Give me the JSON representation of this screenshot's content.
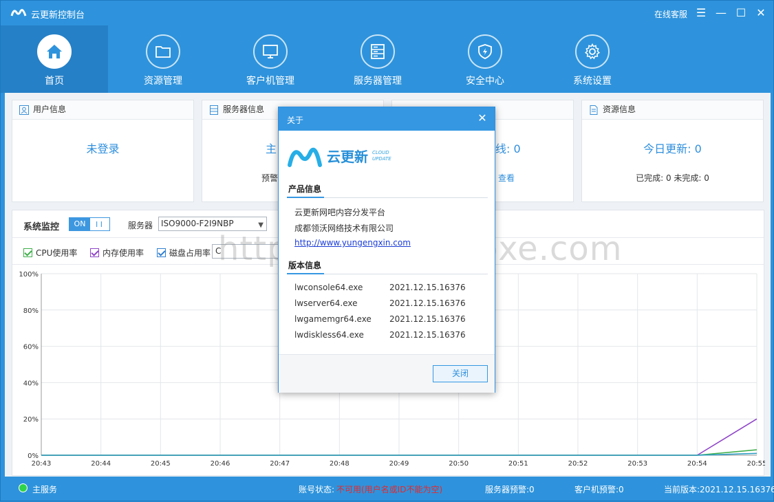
{
  "app": {
    "title": "云更新控制台",
    "online_service": "在线客服"
  },
  "nav": [
    {
      "label": "首页",
      "icon": "home-icon",
      "active": true
    },
    {
      "label": "资源管理",
      "icon": "folder-icon",
      "active": false
    },
    {
      "label": "客户机管理",
      "icon": "monitor-icon",
      "active": false
    },
    {
      "label": "服务器管理",
      "icon": "server-icon",
      "active": false
    },
    {
      "label": "安全中心",
      "icon": "shield-icon",
      "active": false
    },
    {
      "label": "系统设置",
      "icon": "gear-icon",
      "active": false
    }
  ],
  "cards": {
    "user": {
      "title": "用户信息",
      "main": "未登录"
    },
    "server": {
      "title": "服务器信息",
      "main": "主",
      "sub": "预警"
    },
    "client": {
      "main": "线: 0",
      "link": "查看"
    },
    "resource": {
      "title": "资源信息",
      "main": "今日更新: 0",
      "sub": "已完成: 0 未完成: 0"
    }
  },
  "monitor": {
    "title": "系统监控",
    "toggle_on": "ON",
    "toggle_bars": "I I",
    "server_label": "服务器",
    "server_value": "ISO9000-F2I9NBP",
    "checks": [
      {
        "label": "CPU使用率",
        "color": "#3fae49"
      },
      {
        "label": "内存使用率",
        "color": "#8e44c8"
      },
      {
        "label": "磁盘占用率",
        "color": "#2f7fd1"
      }
    ],
    "disk_value": "C"
  },
  "chart_data": {
    "type": "line",
    "x": [
      "20:43",
      "20:44",
      "20:45",
      "20:46",
      "20:47",
      "20:48",
      "20:49",
      "20:50",
      "20:51",
      "20:52",
      "20:53",
      "20:54",
      "20:55"
    ],
    "ylim": [
      0,
      100
    ],
    "y_ticks": [
      "0%",
      "20%",
      "40%",
      "60%",
      "80%",
      "100%"
    ],
    "grid": true,
    "series": [
      {
        "values": [
          0,
          0,
          0,
          0,
          0,
          0,
          0,
          0,
          0,
          0,
          0,
          0,
          20
        ],
        "color": "#8e44c8"
      },
      {
        "values": [
          0,
          0,
          0,
          0,
          0,
          0,
          0,
          0,
          0,
          0,
          0,
          0,
          3
        ],
        "color": "#3fae49"
      },
      {
        "values": [
          0,
          0,
          0,
          0,
          0,
          0,
          0,
          0,
          0,
          0,
          0,
          0,
          1
        ],
        "color": "#2f9fc4"
      }
    ]
  },
  "watermark": "https://www.58pxe.com",
  "status": {
    "main_service": "主服务",
    "account_label": "账号状态:",
    "account_value": "不可用(用户名或ID不能为空)",
    "server_warning": "服务器预警:0",
    "client_warning": "客户机预警:0",
    "version": "当前版本:2021.12.15.16376"
  },
  "dialog": {
    "title": "关于",
    "logo_text": "云更新",
    "logo_sub1": "CLOUD",
    "logo_sub2": "UPDATE",
    "product_title": "产品信息",
    "product_name": "云更新网吧内容分发平台",
    "company": "成都领沃网络技术有限公司",
    "url": "http://www.yungengxin.com",
    "version_title": "版本信息",
    "versions": [
      {
        "file": "lwconsole64.exe",
        "version": "2021.12.15.16376"
      },
      {
        "file": "lwserver64.exe",
        "version": "2021.12.15.16376"
      },
      {
        "file": "lwgamemgr64.exe",
        "version": "2021.12.15.16376"
      },
      {
        "file": "lwdiskless64.exe",
        "version": "2021.12.15.16376"
      }
    ],
    "close_button": "关闭"
  }
}
